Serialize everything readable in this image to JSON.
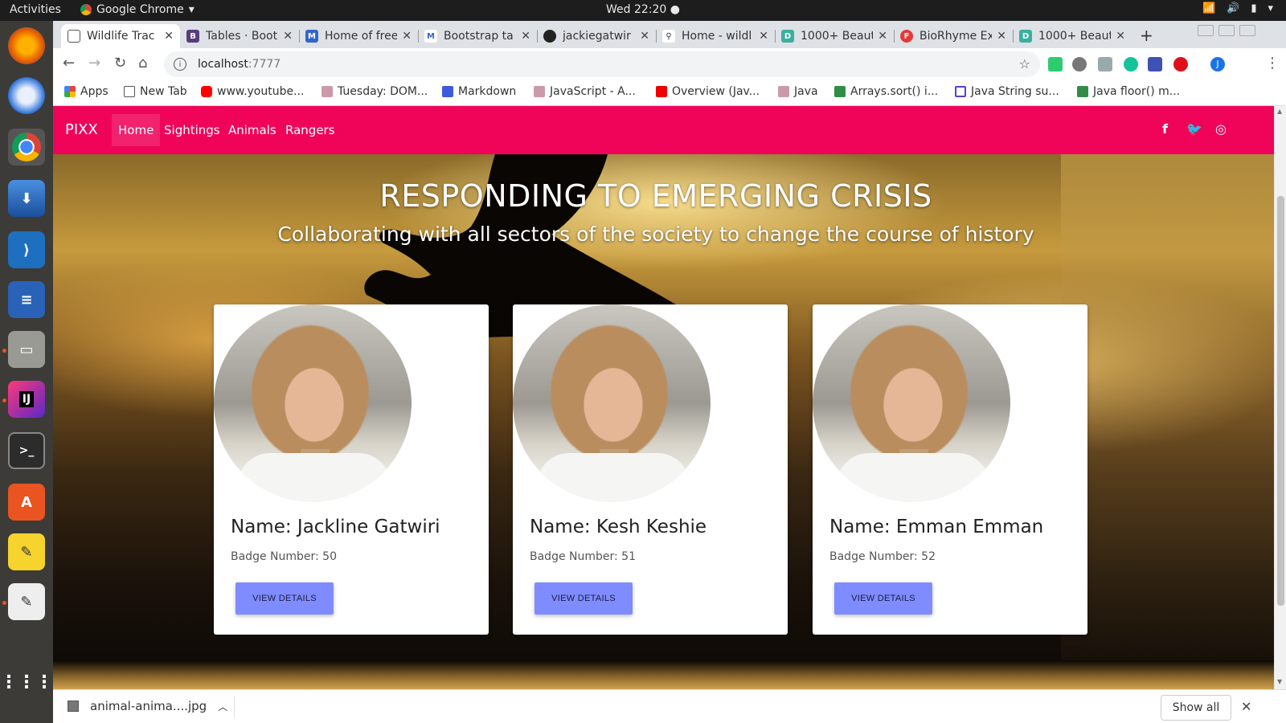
{
  "os": {
    "activities": "Activities",
    "app_name": "Google Chrome",
    "clock": "Wed 22:20"
  },
  "browser": {
    "tabs": [
      {
        "title": "Wildlife Trac",
        "favicon": "page-icon",
        "active": true
      },
      {
        "title": "Tables · Boot",
        "favicon": "bootstrap-icon"
      },
      {
        "title": "Home of free",
        "favicon": "mdb-icon"
      },
      {
        "title": "Bootstrap ta",
        "favicon": "mdb-icon"
      },
      {
        "title": "jackiegatwir",
        "favicon": "github-icon"
      },
      {
        "title": "Home - wildl",
        "favicon": "heroku-icon"
      },
      {
        "title": "1000+ Beauti",
        "favicon": "d-icon"
      },
      {
        "title": "BioRhyme Ex",
        "favicon": "font-icon"
      },
      {
        "title": "1000+ Beauti",
        "favicon": "d-icon"
      }
    ],
    "url_host": "localhost",
    "url_port": ":7777",
    "bookmarks": [
      {
        "label": "Apps",
        "icon": "apps-grid-icon"
      },
      {
        "label": "New Tab",
        "icon": "page-icon"
      },
      {
        "label": "www.youtube...",
        "icon": "youtube-icon"
      },
      {
        "label": "Tuesday: DOM...",
        "icon": "palm-icon"
      },
      {
        "label": "Markdown",
        "icon": "table-icon"
      },
      {
        "label": "JavaScript - A...",
        "icon": "palm-icon"
      },
      {
        "label": "Overview (Jav...",
        "icon": "oracle-icon"
      },
      {
        "label": "Java",
        "icon": "palm-icon"
      },
      {
        "label": "Arrays.sort() i...",
        "icon": "gfg-icon"
      },
      {
        "label": "Java String su...",
        "icon": "bookmark-icon"
      },
      {
        "label": "Java floor() m...",
        "icon": "gfg-icon"
      }
    ]
  },
  "site": {
    "brand": "PIXX",
    "nav": [
      "Home",
      "Sightings",
      "Animals",
      "Rangers"
    ],
    "hero_title": "RESPONDING TO EMERGING CRISIS",
    "hero_subtitle": "Collaborating with all sectors of the society to change the course of history",
    "rangers": [
      {
        "name": "Name: Jackline Gatwiri",
        "badge": "Badge Number: 50",
        "button": "VIEW DETAILS"
      },
      {
        "name": "Name: Kesh Keshie",
        "badge": "Badge Number: 51",
        "button": "VIEW DETAILS"
      },
      {
        "name": "Name: Emman Emman",
        "badge": "Badge Number: 52",
        "button": "VIEW DETAILS"
      }
    ],
    "social": [
      "f",
      "twitter-bird",
      "instagram"
    ]
  },
  "downloads": {
    "file": "animal-anima....jpg",
    "show_all": "Show all"
  },
  "colors": {
    "navbar": "#f0045a",
    "button": "#7f8cff"
  }
}
